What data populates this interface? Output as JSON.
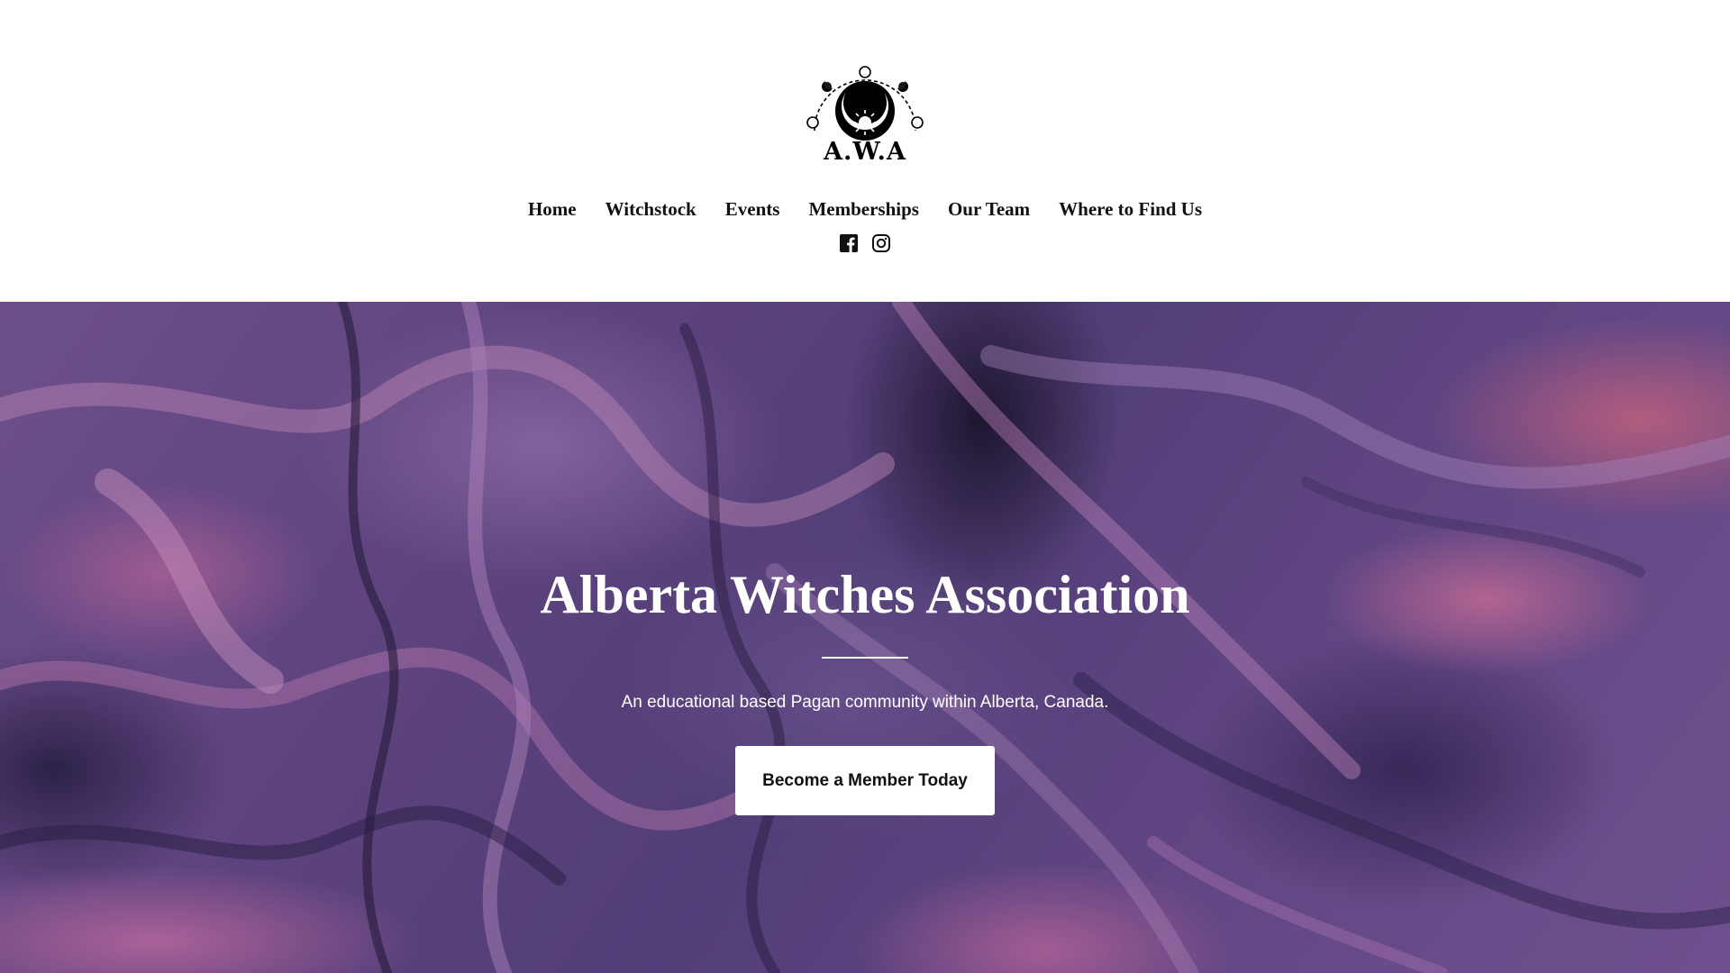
{
  "header": {
    "logo": {
      "text": "A.W.A",
      "icon": "crescent-moon-sun-emblem-icon"
    },
    "nav": [
      {
        "label": "Home"
      },
      {
        "label": "Witchstock"
      },
      {
        "label": "Events"
      },
      {
        "label": "Memberships"
      },
      {
        "label": "Our Team"
      },
      {
        "label": "Where to Find Us"
      }
    ],
    "social": [
      {
        "icon": "facebook-icon"
      },
      {
        "icon": "instagram-icon"
      }
    ]
  },
  "hero": {
    "title": "Alberta Witches Association",
    "subtitle": "An educational based Pagan community within Alberta, Canada.",
    "cta_label": "Become a Member Today",
    "colors": {
      "deep_purple": "#5b4684",
      "pink": "#d676a5",
      "text": "#ffffff"
    }
  }
}
